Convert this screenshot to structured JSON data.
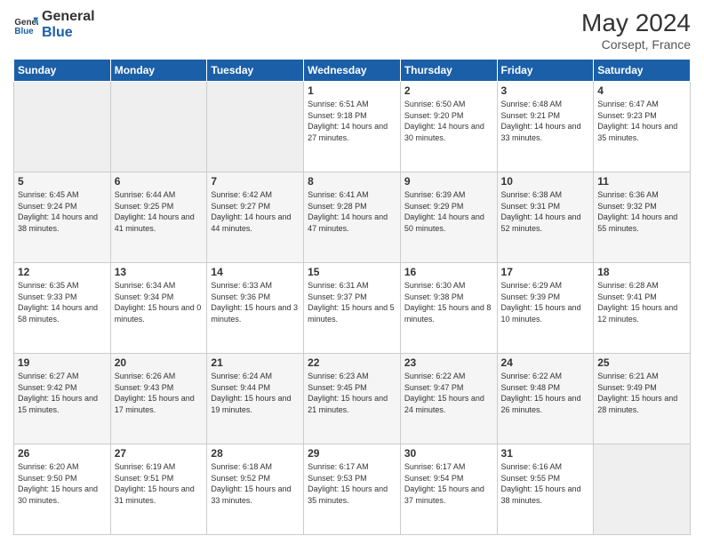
{
  "header": {
    "logo_general": "General",
    "logo_blue": "Blue",
    "month_year": "May 2024",
    "location": "Corsept, France"
  },
  "weekdays": [
    "Sunday",
    "Monday",
    "Tuesday",
    "Wednesday",
    "Thursday",
    "Friday",
    "Saturday"
  ],
  "weeks": [
    [
      {
        "day": "",
        "sunrise": "",
        "sunset": "",
        "daylight": ""
      },
      {
        "day": "",
        "sunrise": "",
        "sunset": "",
        "daylight": ""
      },
      {
        "day": "",
        "sunrise": "",
        "sunset": "",
        "daylight": ""
      },
      {
        "day": "1",
        "sunrise": "Sunrise: 6:51 AM",
        "sunset": "Sunset: 9:18 PM",
        "daylight": "Daylight: 14 hours and 27 minutes."
      },
      {
        "day": "2",
        "sunrise": "Sunrise: 6:50 AM",
        "sunset": "Sunset: 9:20 PM",
        "daylight": "Daylight: 14 hours and 30 minutes."
      },
      {
        "day": "3",
        "sunrise": "Sunrise: 6:48 AM",
        "sunset": "Sunset: 9:21 PM",
        "daylight": "Daylight: 14 hours and 33 minutes."
      },
      {
        "day": "4",
        "sunrise": "Sunrise: 6:47 AM",
        "sunset": "Sunset: 9:23 PM",
        "daylight": "Daylight: 14 hours and 35 minutes."
      }
    ],
    [
      {
        "day": "5",
        "sunrise": "Sunrise: 6:45 AM",
        "sunset": "Sunset: 9:24 PM",
        "daylight": "Daylight: 14 hours and 38 minutes."
      },
      {
        "day": "6",
        "sunrise": "Sunrise: 6:44 AM",
        "sunset": "Sunset: 9:25 PM",
        "daylight": "Daylight: 14 hours and 41 minutes."
      },
      {
        "day": "7",
        "sunrise": "Sunrise: 6:42 AM",
        "sunset": "Sunset: 9:27 PM",
        "daylight": "Daylight: 14 hours and 44 minutes."
      },
      {
        "day": "8",
        "sunrise": "Sunrise: 6:41 AM",
        "sunset": "Sunset: 9:28 PM",
        "daylight": "Daylight: 14 hours and 47 minutes."
      },
      {
        "day": "9",
        "sunrise": "Sunrise: 6:39 AM",
        "sunset": "Sunset: 9:29 PM",
        "daylight": "Daylight: 14 hours and 50 minutes."
      },
      {
        "day": "10",
        "sunrise": "Sunrise: 6:38 AM",
        "sunset": "Sunset: 9:31 PM",
        "daylight": "Daylight: 14 hours and 52 minutes."
      },
      {
        "day": "11",
        "sunrise": "Sunrise: 6:36 AM",
        "sunset": "Sunset: 9:32 PM",
        "daylight": "Daylight: 14 hours and 55 minutes."
      }
    ],
    [
      {
        "day": "12",
        "sunrise": "Sunrise: 6:35 AM",
        "sunset": "Sunset: 9:33 PM",
        "daylight": "Daylight: 14 hours and 58 minutes."
      },
      {
        "day": "13",
        "sunrise": "Sunrise: 6:34 AM",
        "sunset": "Sunset: 9:34 PM",
        "daylight": "Daylight: 15 hours and 0 minutes."
      },
      {
        "day": "14",
        "sunrise": "Sunrise: 6:33 AM",
        "sunset": "Sunset: 9:36 PM",
        "daylight": "Daylight: 15 hours and 3 minutes."
      },
      {
        "day": "15",
        "sunrise": "Sunrise: 6:31 AM",
        "sunset": "Sunset: 9:37 PM",
        "daylight": "Daylight: 15 hours and 5 minutes."
      },
      {
        "day": "16",
        "sunrise": "Sunrise: 6:30 AM",
        "sunset": "Sunset: 9:38 PM",
        "daylight": "Daylight: 15 hours and 8 minutes."
      },
      {
        "day": "17",
        "sunrise": "Sunrise: 6:29 AM",
        "sunset": "Sunset: 9:39 PM",
        "daylight": "Daylight: 15 hours and 10 minutes."
      },
      {
        "day": "18",
        "sunrise": "Sunrise: 6:28 AM",
        "sunset": "Sunset: 9:41 PM",
        "daylight": "Daylight: 15 hours and 12 minutes."
      }
    ],
    [
      {
        "day": "19",
        "sunrise": "Sunrise: 6:27 AM",
        "sunset": "Sunset: 9:42 PM",
        "daylight": "Daylight: 15 hours and 15 minutes."
      },
      {
        "day": "20",
        "sunrise": "Sunrise: 6:26 AM",
        "sunset": "Sunset: 9:43 PM",
        "daylight": "Daylight: 15 hours and 17 minutes."
      },
      {
        "day": "21",
        "sunrise": "Sunrise: 6:24 AM",
        "sunset": "Sunset: 9:44 PM",
        "daylight": "Daylight: 15 hours and 19 minutes."
      },
      {
        "day": "22",
        "sunrise": "Sunrise: 6:23 AM",
        "sunset": "Sunset: 9:45 PM",
        "daylight": "Daylight: 15 hours and 21 minutes."
      },
      {
        "day": "23",
        "sunrise": "Sunrise: 6:22 AM",
        "sunset": "Sunset: 9:47 PM",
        "daylight": "Daylight: 15 hours and 24 minutes."
      },
      {
        "day": "24",
        "sunrise": "Sunrise: 6:22 AM",
        "sunset": "Sunset: 9:48 PM",
        "daylight": "Daylight: 15 hours and 26 minutes."
      },
      {
        "day": "25",
        "sunrise": "Sunrise: 6:21 AM",
        "sunset": "Sunset: 9:49 PM",
        "daylight": "Daylight: 15 hours and 28 minutes."
      }
    ],
    [
      {
        "day": "26",
        "sunrise": "Sunrise: 6:20 AM",
        "sunset": "Sunset: 9:50 PM",
        "daylight": "Daylight: 15 hours and 30 minutes."
      },
      {
        "day": "27",
        "sunrise": "Sunrise: 6:19 AM",
        "sunset": "Sunset: 9:51 PM",
        "daylight": "Daylight: 15 hours and 31 minutes."
      },
      {
        "day": "28",
        "sunrise": "Sunrise: 6:18 AM",
        "sunset": "Sunset: 9:52 PM",
        "daylight": "Daylight: 15 hours and 33 minutes."
      },
      {
        "day": "29",
        "sunrise": "Sunrise: 6:17 AM",
        "sunset": "Sunset: 9:53 PM",
        "daylight": "Daylight: 15 hours and 35 minutes."
      },
      {
        "day": "30",
        "sunrise": "Sunrise: 6:17 AM",
        "sunset": "Sunset: 9:54 PM",
        "daylight": "Daylight: 15 hours and 37 minutes."
      },
      {
        "day": "31",
        "sunrise": "Sunrise: 6:16 AM",
        "sunset": "Sunset: 9:55 PM",
        "daylight": "Daylight: 15 hours and 38 minutes."
      },
      {
        "day": "",
        "sunrise": "",
        "sunset": "",
        "daylight": ""
      }
    ]
  ]
}
